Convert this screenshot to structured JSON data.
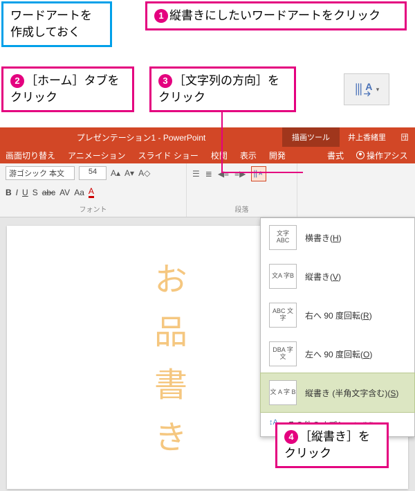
{
  "callouts": {
    "prep": "ワードアートを作成しておく",
    "c1": "縦書きにしたいワードアートをクリック",
    "c2": "［ホーム］タブをクリック",
    "c3": "［文字列の方向］をクリック",
    "c4": "［縦書き］をクリック",
    "n1": "1",
    "n2": "2",
    "n3": "3",
    "n4": "4"
  },
  "titlebar": {
    "title": "プレゼンテーション1 - PowerPoint",
    "tool": "描画ツール",
    "user": "井上香緒里",
    "winicon": "団"
  },
  "tabs": {
    "t2": "画面切り替え",
    "t3": "アニメーション",
    "t4": "スライド ショー",
    "t5": "校閲",
    "t6": "表示",
    "t7": "開発",
    "t8": "書式",
    "assist": "操作アシス"
  },
  "ribbon": {
    "fontname": "游ゴシック 本文",
    "fontsize": "54",
    "fontlabel": "フォント",
    "paralabel": "段落",
    "b": "B",
    "i": "I",
    "u": "U",
    "s": "S",
    "abc": "abc",
    "av": "AV",
    "aa": "Aa",
    "aplus": "A▴",
    "aminus": "A▾",
    "aclear": "A◇"
  },
  "wordart": "お品書き",
  "dropdown": {
    "item1_label": "横書き(",
    "item1_key": "H",
    "item1_icon": "文字\nABC",
    "item2_label": "縦書き(",
    "item2_key": "V",
    "item2_icon": "文A\n字B",
    "item3_label": "右へ 90 度回転(",
    "item3_key": "R",
    "item3_icon": "ABC\n文字",
    "item4_label": "左へ 90 度回転(",
    "item4_key": "O",
    "item4_icon": "DBA\n字文",
    "item5_label": "縦書き (半角文字含む)(",
    "item5_key": "S",
    "item5_icon": "文 A\n字 B",
    "close": ")",
    "footer": "その他のオプション(",
    "footer_key": "M",
    "footer_close": ")..."
  },
  "icons": {
    "textdir": "text-direction-icon"
  }
}
